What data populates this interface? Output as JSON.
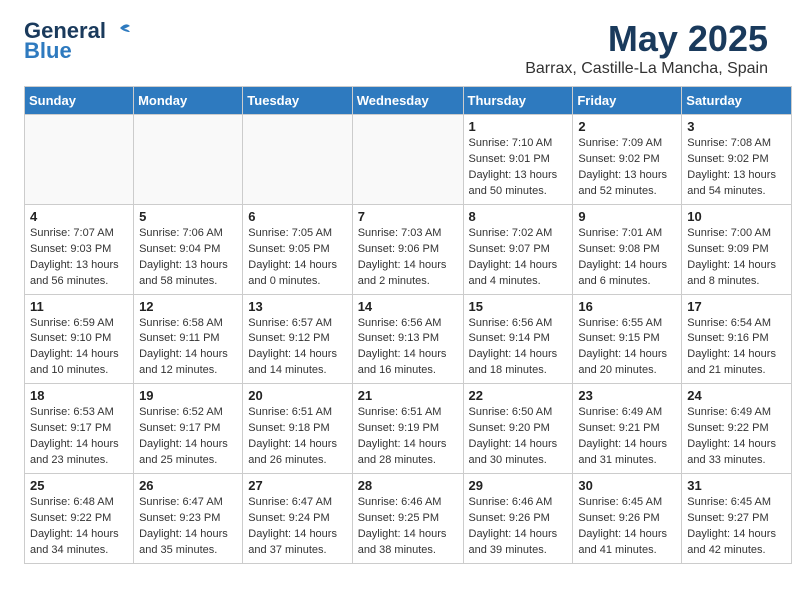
{
  "header": {
    "logo_general": "General",
    "logo_blue": "Blue",
    "month_title": "May 2025",
    "location": "Barrax, Castille-La Mancha, Spain"
  },
  "weekdays": [
    "Sunday",
    "Monday",
    "Tuesday",
    "Wednesday",
    "Thursday",
    "Friday",
    "Saturday"
  ],
  "weeks": [
    [
      {
        "day": "",
        "content": ""
      },
      {
        "day": "",
        "content": ""
      },
      {
        "day": "",
        "content": ""
      },
      {
        "day": "",
        "content": ""
      },
      {
        "day": "1",
        "content": "Sunrise: 7:10 AM\nSunset: 9:01 PM\nDaylight: 13 hours and 50 minutes."
      },
      {
        "day": "2",
        "content": "Sunrise: 7:09 AM\nSunset: 9:02 PM\nDaylight: 13 hours and 52 minutes."
      },
      {
        "day": "3",
        "content": "Sunrise: 7:08 AM\nSunset: 9:02 PM\nDaylight: 13 hours and 54 minutes."
      }
    ],
    [
      {
        "day": "4",
        "content": "Sunrise: 7:07 AM\nSunset: 9:03 PM\nDaylight: 13 hours and 56 minutes."
      },
      {
        "day": "5",
        "content": "Sunrise: 7:06 AM\nSunset: 9:04 PM\nDaylight: 13 hours and 58 minutes."
      },
      {
        "day": "6",
        "content": "Sunrise: 7:05 AM\nSunset: 9:05 PM\nDaylight: 14 hours and 0 minutes."
      },
      {
        "day": "7",
        "content": "Sunrise: 7:03 AM\nSunset: 9:06 PM\nDaylight: 14 hours and 2 minutes."
      },
      {
        "day": "8",
        "content": "Sunrise: 7:02 AM\nSunset: 9:07 PM\nDaylight: 14 hours and 4 minutes."
      },
      {
        "day": "9",
        "content": "Sunrise: 7:01 AM\nSunset: 9:08 PM\nDaylight: 14 hours and 6 minutes."
      },
      {
        "day": "10",
        "content": "Sunrise: 7:00 AM\nSunset: 9:09 PM\nDaylight: 14 hours and 8 minutes."
      }
    ],
    [
      {
        "day": "11",
        "content": "Sunrise: 6:59 AM\nSunset: 9:10 PM\nDaylight: 14 hours and 10 minutes."
      },
      {
        "day": "12",
        "content": "Sunrise: 6:58 AM\nSunset: 9:11 PM\nDaylight: 14 hours and 12 minutes."
      },
      {
        "day": "13",
        "content": "Sunrise: 6:57 AM\nSunset: 9:12 PM\nDaylight: 14 hours and 14 minutes."
      },
      {
        "day": "14",
        "content": "Sunrise: 6:56 AM\nSunset: 9:13 PM\nDaylight: 14 hours and 16 minutes."
      },
      {
        "day": "15",
        "content": "Sunrise: 6:56 AM\nSunset: 9:14 PM\nDaylight: 14 hours and 18 minutes."
      },
      {
        "day": "16",
        "content": "Sunrise: 6:55 AM\nSunset: 9:15 PM\nDaylight: 14 hours and 20 minutes."
      },
      {
        "day": "17",
        "content": "Sunrise: 6:54 AM\nSunset: 9:16 PM\nDaylight: 14 hours and 21 minutes."
      }
    ],
    [
      {
        "day": "18",
        "content": "Sunrise: 6:53 AM\nSunset: 9:17 PM\nDaylight: 14 hours and 23 minutes."
      },
      {
        "day": "19",
        "content": "Sunrise: 6:52 AM\nSunset: 9:17 PM\nDaylight: 14 hours and 25 minutes."
      },
      {
        "day": "20",
        "content": "Sunrise: 6:51 AM\nSunset: 9:18 PM\nDaylight: 14 hours and 26 minutes."
      },
      {
        "day": "21",
        "content": "Sunrise: 6:51 AM\nSunset: 9:19 PM\nDaylight: 14 hours and 28 minutes."
      },
      {
        "day": "22",
        "content": "Sunrise: 6:50 AM\nSunset: 9:20 PM\nDaylight: 14 hours and 30 minutes."
      },
      {
        "day": "23",
        "content": "Sunrise: 6:49 AM\nSunset: 9:21 PM\nDaylight: 14 hours and 31 minutes."
      },
      {
        "day": "24",
        "content": "Sunrise: 6:49 AM\nSunset: 9:22 PM\nDaylight: 14 hours and 33 minutes."
      }
    ],
    [
      {
        "day": "25",
        "content": "Sunrise: 6:48 AM\nSunset: 9:22 PM\nDaylight: 14 hours and 34 minutes."
      },
      {
        "day": "26",
        "content": "Sunrise: 6:47 AM\nSunset: 9:23 PM\nDaylight: 14 hours and 35 minutes."
      },
      {
        "day": "27",
        "content": "Sunrise: 6:47 AM\nSunset: 9:24 PM\nDaylight: 14 hours and 37 minutes."
      },
      {
        "day": "28",
        "content": "Sunrise: 6:46 AM\nSunset: 9:25 PM\nDaylight: 14 hours and 38 minutes."
      },
      {
        "day": "29",
        "content": "Sunrise: 6:46 AM\nSunset: 9:26 PM\nDaylight: 14 hours and 39 minutes."
      },
      {
        "day": "30",
        "content": "Sunrise: 6:45 AM\nSunset: 9:26 PM\nDaylight: 14 hours and 41 minutes."
      },
      {
        "day": "31",
        "content": "Sunrise: 6:45 AM\nSunset: 9:27 PM\nDaylight: 14 hours and 42 minutes."
      }
    ]
  ]
}
